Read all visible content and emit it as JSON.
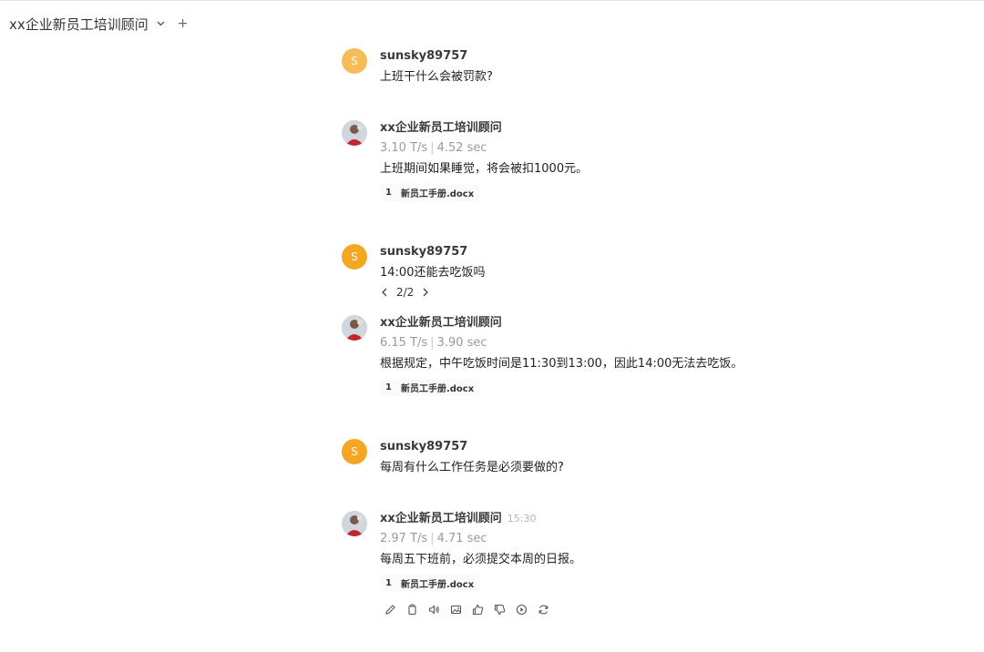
{
  "header": {
    "title": "xx企业新员工培训顾问"
  },
  "messages": [
    {
      "role": "user",
      "avatar_letter": "S",
      "name": "sunsky89757",
      "text": "上班干什么会被罚款?"
    },
    {
      "role": "bot",
      "name": "xx企业新员工培训顾问",
      "speed": "3.10 T/s",
      "duration": "4.52 sec",
      "text": "上班期间如果睡觉，将会被扣1000元。",
      "cite_index": "1",
      "cite_file": "新员工手册.docx"
    },
    {
      "role": "user",
      "avatar_letter": "S",
      "name": "sunsky89757",
      "text": "14:00还能去吃饭吗",
      "pager": "2/2"
    },
    {
      "role": "bot",
      "name": "xx企业新员工培训顾问",
      "speed": "6.15 T/s",
      "duration": "3.90 sec",
      "text": "根据规定，中午吃饭时间是11:30到13:00，因此14:00无法去吃饭。",
      "cite_index": "1",
      "cite_file": "新员工手册.docx"
    },
    {
      "role": "user",
      "avatar_letter": "S",
      "name": "sunsky89757",
      "text": "每周有什么工作任务是必须要做的?"
    },
    {
      "role": "bot",
      "name": "xx企业新员工培训顾问",
      "time": "15:30",
      "speed": "2.97 T/s",
      "duration": "4.71 sec",
      "text": "每周五下班前，必须提交本周的日报。",
      "cite_index": "1",
      "cite_file": "新员工手册.docx"
    }
  ],
  "colors": {
    "user_avatar": "#f5a623",
    "muted_text": "#9a9a9a"
  },
  "action_icons": [
    "edit-icon",
    "copy-icon",
    "speaker-icon",
    "image-icon",
    "thumbs-up-icon",
    "thumbs-down-icon",
    "play-icon",
    "regenerate-icon"
  ]
}
